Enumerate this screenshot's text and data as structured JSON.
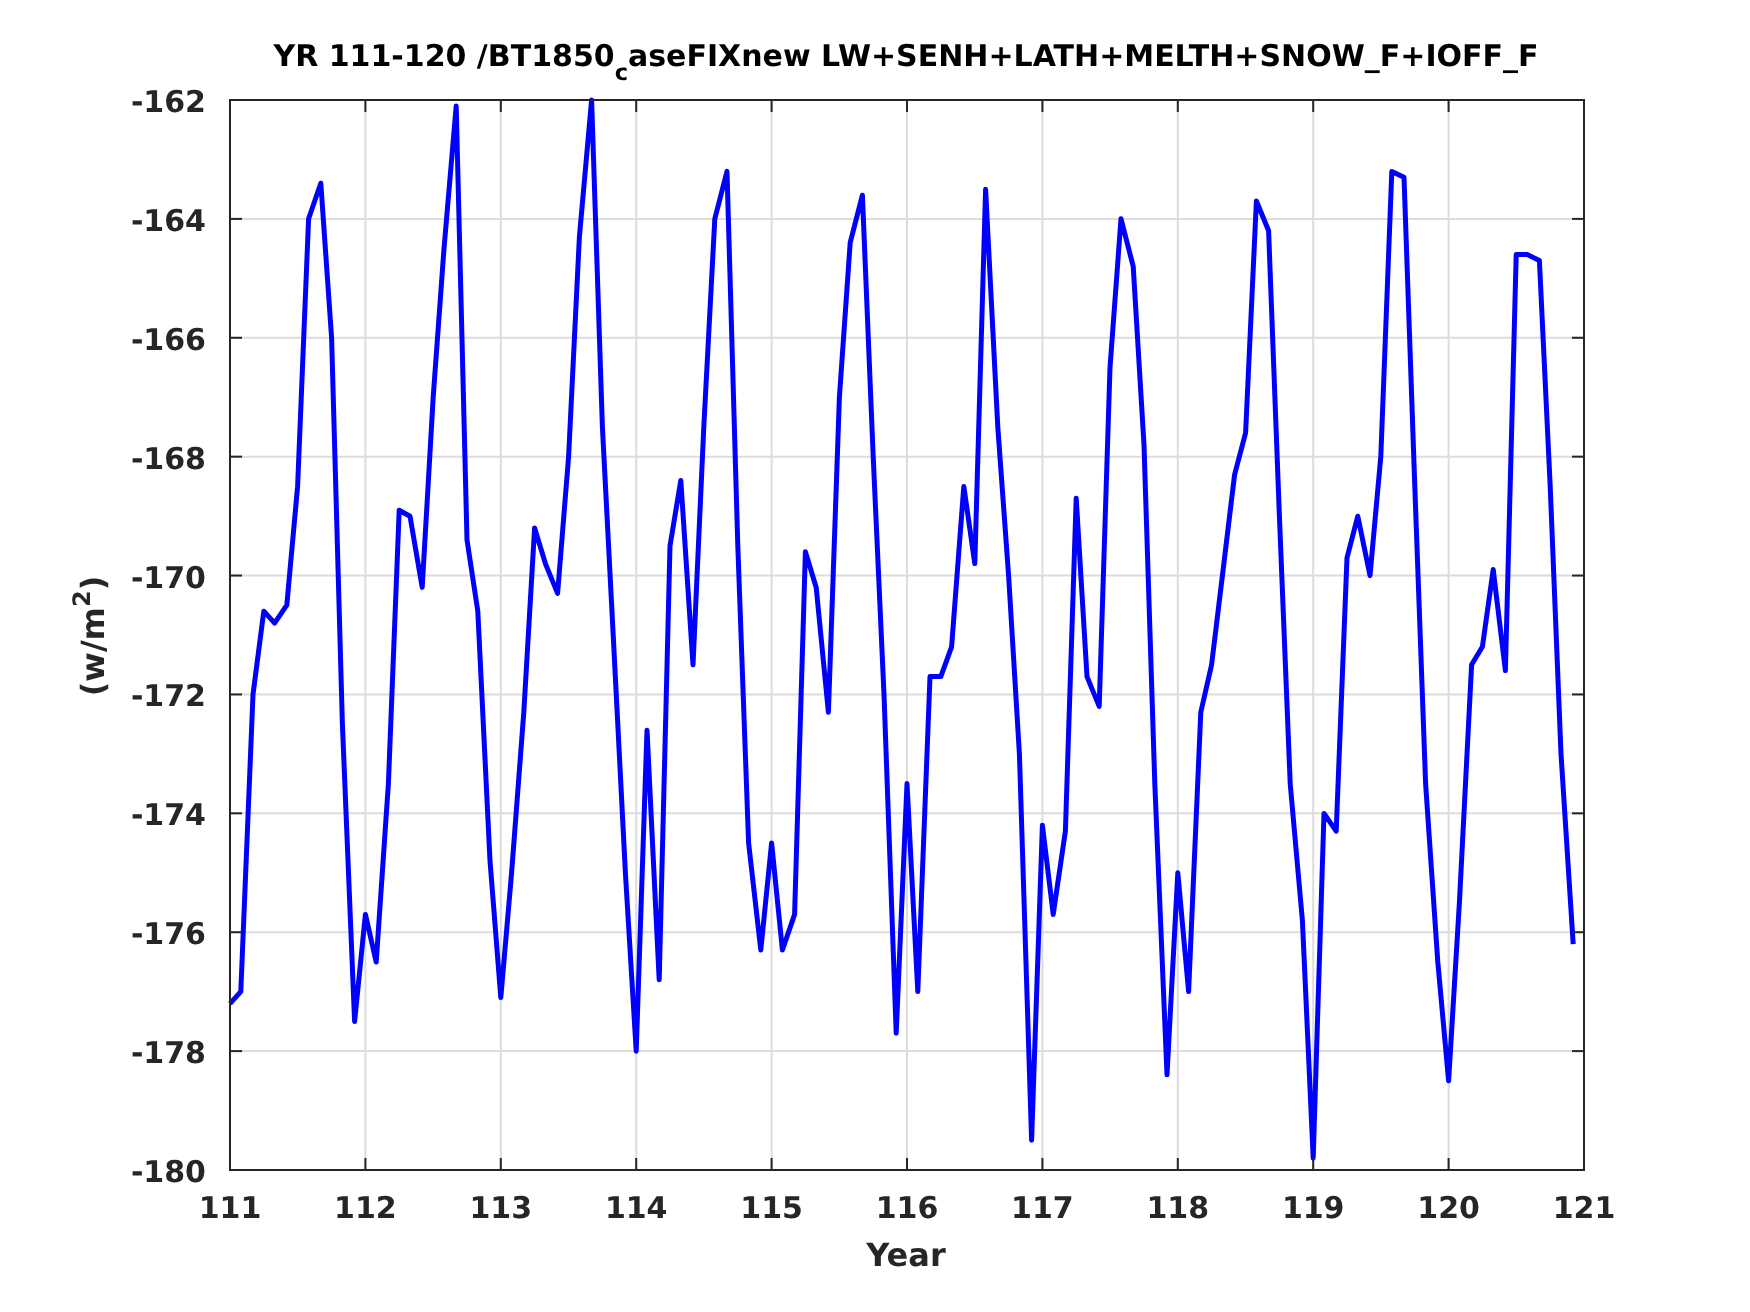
{
  "figure": {
    "chart_data": {
      "type": "line",
      "grid": true,
      "title": "YR 111-120 /BT1850$_{c}$aseFIXnew LW+SENH+LATH+MELTH+SNOW_F+IOFF_F",
      "xlabel": "Year",
      "ylabel": "(w/m$^{2}$)",
      "xlim": [
        111,
        121
      ],
      "ylim": [
        -180,
        -162
      ],
      "xticks": [
        111,
        112,
        113,
        114,
        115,
        116,
        117,
        118,
        119,
        120,
        121
      ],
      "yticks": [
        -180,
        -178,
        -176,
        -174,
        -172,
        -170,
        -168,
        -166,
        -164,
        -162
      ],
      "x": [
        111,
        111.08,
        111.17,
        111.25,
        111.33,
        111.42,
        111.5,
        111.58,
        111.67,
        111.75,
        111.83,
        111.92,
        112,
        112.08,
        112.17,
        112.25,
        112.33,
        112.42,
        112.5,
        112.58,
        112.67,
        112.75,
        112.83,
        112.92,
        113,
        113.08,
        113.17,
        113.25,
        113.33,
        113.42,
        113.5,
        113.58,
        113.67,
        113.75,
        113.83,
        113.92,
        114,
        114.08,
        114.17,
        114.25,
        114.33,
        114.42,
        114.5,
        114.58,
        114.67,
        114.75,
        114.83,
        114.92,
        115,
        115.08,
        115.17,
        115.25,
        115.33,
        115.42,
        115.5,
        115.58,
        115.67,
        115.75,
        115.83,
        115.92,
        116,
        116.08,
        116.17,
        116.25,
        116.33,
        116.42,
        116.5,
        116.58,
        116.67,
        116.75,
        116.83,
        116.92,
        117,
        117.08,
        117.17,
        117.25,
        117.33,
        117.42,
        117.5,
        117.58,
        117.67,
        117.75,
        117.83,
        117.92,
        118,
        118.08,
        118.17,
        118.25,
        118.33,
        118.42,
        118.5,
        118.58,
        118.67,
        118.75,
        118.83,
        118.92,
        119,
        119.08,
        119.17,
        119.25,
        119.33,
        119.42,
        119.5,
        119.58,
        119.67,
        119.75,
        119.83,
        119.92,
        120,
        120.08,
        120.17,
        120.25,
        120.33,
        120.42,
        120.5,
        120.58,
        120.67,
        120.75,
        120.83,
        120.92
      ],
      "series": [
        {
          "color": "#0000ff",
          "values": [
            -177.2,
            -177.0,
            -172.0,
            -170.6,
            -170.8,
            -170.5,
            -168.5,
            -164.0,
            -163.4,
            -166.0,
            -172.5,
            -177.5,
            -175.7,
            -176.5,
            -173.5,
            -168.9,
            -169.0,
            -170.2,
            -167.0,
            -164.5,
            -162.1,
            -169.4,
            -170.6,
            -174.8,
            -177.1,
            -175.0,
            -172.3,
            -169.2,
            -169.8,
            -170.3,
            -168.0,
            -164.3,
            -162.0,
            -167.5,
            -171.0,
            -175.0,
            -178.0,
            -172.6,
            -176.8,
            -169.5,
            -168.4,
            -171.5,
            -167.5,
            -164.0,
            -163.2,
            -169.5,
            -174.5,
            -176.3,
            -174.5,
            -176.3,
            -175.7,
            -169.6,
            -170.2,
            -172.3,
            -167.0,
            -164.4,
            -163.6,
            -168.0,
            -172.0,
            -177.7,
            -173.5,
            -177.0,
            -171.7,
            -171.7,
            -171.2,
            -168.5,
            -169.8,
            -163.5,
            -167.5,
            -170.0,
            -173.0,
            -179.5,
            -174.2,
            -175.7,
            -174.3,
            -168.7,
            -171.7,
            -172.2,
            -166.5,
            -164.0,
            -164.8,
            -167.8,
            -173.5,
            -178.4,
            -175.0,
            -177.0,
            -172.3,
            -171.5,
            -170.0,
            -168.3,
            -167.6,
            -163.7,
            -164.2,
            -169.0,
            -173.5,
            -175.8,
            -179.8,
            -174.0,
            -174.3,
            -169.7,
            -169.0,
            -170.0,
            -168.0,
            -163.2,
            -163.3,
            -168.5,
            -173.5,
            -176.5,
            -178.5,
            -175.5,
            -171.5,
            -171.2,
            -169.9,
            -171.6,
            -164.6,
            -164.6,
            -164.7,
            -168.5,
            -173.0,
            -176.2
          ]
        }
      ]
    }
  }
}
